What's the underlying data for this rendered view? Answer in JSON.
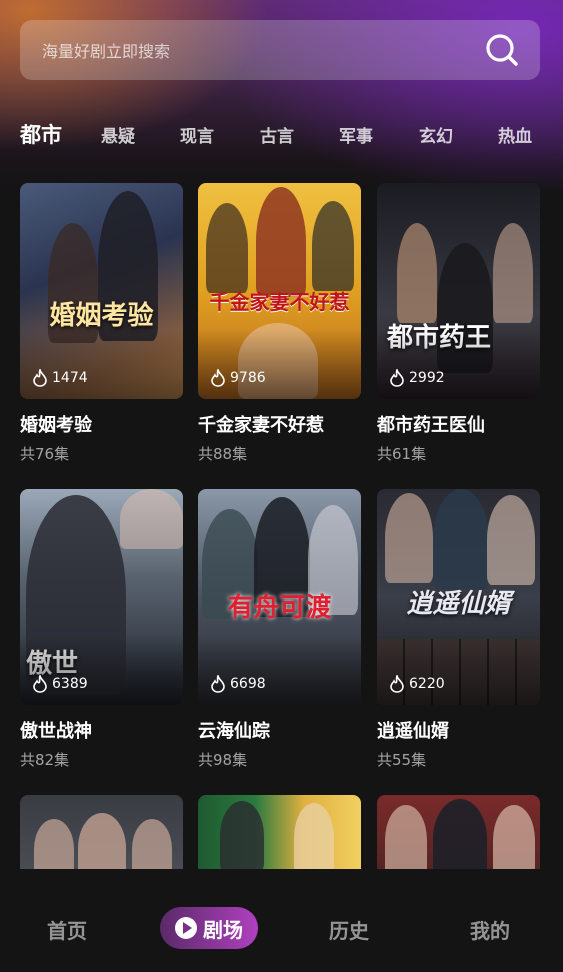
{
  "search": {
    "placeholder": "海量好剧立即搜索",
    "icon": "search-icon"
  },
  "categories": [
    "都市",
    "悬疑",
    "现言",
    "古言",
    "军事",
    "玄幻",
    "热血"
  ],
  "active_category": "都市",
  "dramas": [
    {
      "name": "婚姻考验",
      "episodes": "共76集",
      "views": "1474",
      "poster_title": "婚姻考验",
      "colors": [
        "#3a4a6a",
        "#8a6a4a"
      ]
    },
    {
      "name": "千金家妻不好惹",
      "episodes": "共88集",
      "views": "9786",
      "poster_title": "千金家妻不好惹",
      "colors": [
        "#e0a020",
        "#a05a18"
      ]
    },
    {
      "name": "都市药王医仙",
      "episodes": "共61集",
      "views": "2992",
      "poster_title": "都市药王",
      "colors": [
        "#2a2a30",
        "#5a4a40"
      ]
    },
    {
      "name": "傲世战神",
      "episodes": "共82集",
      "views": "6389",
      "poster_title": "傲世",
      "colors": [
        "#7a8a9a",
        "#2a2e38"
      ]
    },
    {
      "name": "云海仙踪",
      "episodes": "共98集",
      "views": "6698",
      "poster_title": "有舟可渡",
      "colors": [
        "#6a7a8a",
        "#3a3a44"
      ]
    },
    {
      "name": "逍遥仙婿",
      "episodes": "共55集",
      "views": "6220",
      "poster_title": "逍遥仙婿",
      "colors": [
        "#3a3a44",
        "#1e1e24"
      ]
    },
    {
      "name": "",
      "episodes": "",
      "views": "",
      "poster_title": "",
      "colors": [
        "#4a4a52",
        "#8a8a92"
      ]
    },
    {
      "name": "",
      "episodes": "",
      "views": "",
      "poster_title": "",
      "colors": [
        "#2a6a3a",
        "#d0a040"
      ]
    },
    {
      "name": "",
      "episodes": "",
      "views": "",
      "poster_title": "",
      "colors": [
        "#6a2a2a",
        "#2a2a2e"
      ]
    }
  ],
  "nav": {
    "home": "首页",
    "theater": "剧场",
    "history": "历史",
    "mine": "我的"
  }
}
